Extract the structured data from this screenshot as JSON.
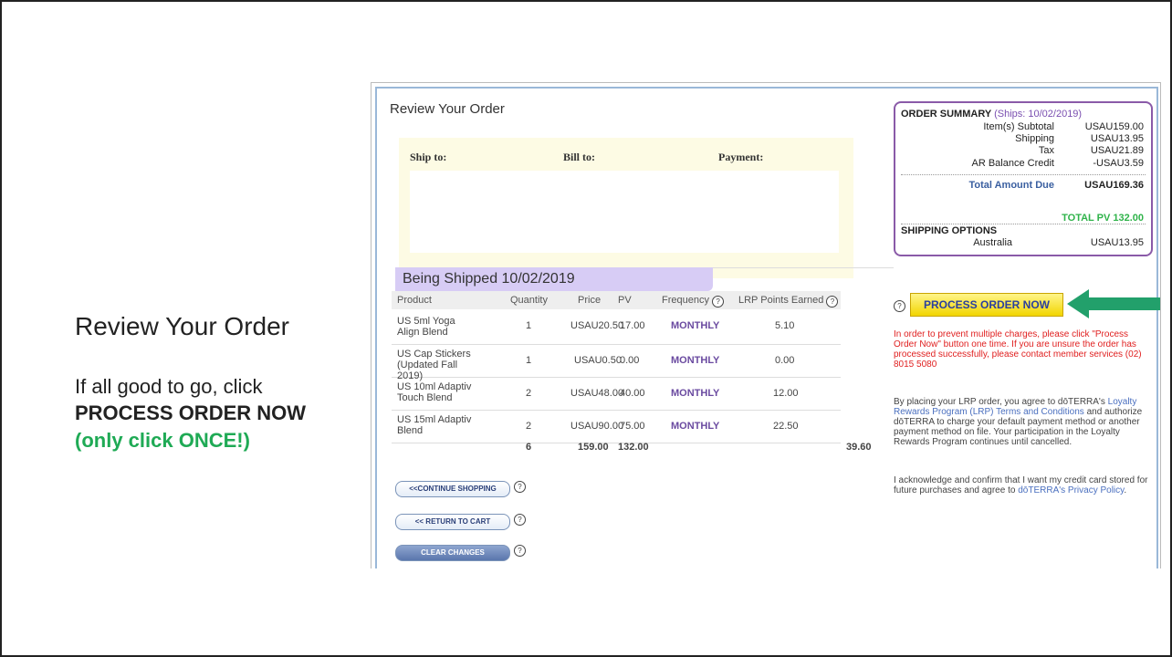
{
  "slide": {
    "title": "Review Your Order",
    "instruction": "If all good to go, click",
    "action": "PROCESS ORDER NOW",
    "note": "(only click ONCE!)"
  },
  "page": {
    "title": "Review Your Order",
    "ship_to": "Ship to:",
    "bill_to": "Bill to:",
    "payment": "Payment:"
  },
  "summary": {
    "heading": "ORDER SUMMARY",
    "ships": "(Ships: 10/02/2019)",
    "rows": [
      {
        "label": "Item(s) Subtotal",
        "value": "USAU159.00"
      },
      {
        "label": "Shipping",
        "value": "USAU13.95"
      },
      {
        "label": "Tax",
        "value": "USAU21.89"
      },
      {
        "label": "AR Balance Credit",
        "value": "-USAU3.59"
      }
    ],
    "total_label": "Total Amount Due",
    "total_value": "USAU169.36",
    "total_pv": "TOTAL PV 132.00",
    "shipping_heading": "SHIPPING OPTIONS",
    "shipping_country": "Australia",
    "shipping_value": "USAU13.95"
  },
  "shipment": {
    "title": "Being Shipped 10/02/2019",
    "headers": {
      "product": "Product",
      "quantity": "Quantity",
      "price": "Price",
      "pv": "PV",
      "frequency": "Frequency",
      "lrp": "LRP Points Earned"
    },
    "items": [
      {
        "product": "US 5ml Yoga Align Blend",
        "qty": "1",
        "price": "USAU20.50",
        "pv": "17.00",
        "freq": "MONTHLY",
        "lrp": "5.10"
      },
      {
        "product": "US Cap Stickers (Updated Fall 2019)",
        "qty": "1",
        "price": "USAU0.50",
        "pv": "0.00",
        "freq": "MONTHLY",
        "lrp": "0.00"
      },
      {
        "product": "US 10ml Adaptiv Touch Blend",
        "qty": "2",
        "price": "USAU48.00",
        "pv": "40.00",
        "freq": "MONTHLY",
        "lrp": "12.00"
      },
      {
        "product": "US 15ml Adaptiv Blend",
        "qty": "2",
        "price": "USAU90.00",
        "pv": "75.00",
        "freq": "MONTHLY",
        "lrp": "22.50"
      }
    ],
    "totals": {
      "qty": "6",
      "price": "159.00",
      "pv": "132.00",
      "lrp": "39.60"
    }
  },
  "buttons": {
    "continue_shopping": "<<CONTINUE SHOPPING",
    "return_to_cart": "<< RETURN TO CART",
    "clear_changes": "CLEAR CHANGES",
    "process_order": "PROCESS ORDER NOW"
  },
  "help_glyph": "?",
  "notes": {
    "warning": "In order to prevent multiple charges, please click \"Process Order Now\" button one time. If you are unsure the order has processed successfully, please contact member services (02) 8015 5080",
    "agree_prefix": "By placing your LRP order, you agree to dōTERRA's",
    "agree_link": "Loyalty Rewards Program (LRP) Terms and Conditions",
    "agree_suffix": "and authorize dōTERRA to charge your default payment method or another payment method on file. Your participation in the Loyalty Rewards Program continues until cancelled.",
    "ack_prefix": "I acknowledge and confirm that I want my credit card stored for future purchases and agree to",
    "ack_link": "dōTERRA's Privacy Policy",
    "ack_suffix": "."
  },
  "colors": {
    "accent_green": "#1faa55",
    "arrow_green": "#22a06b",
    "summary_border": "#8a5aa8",
    "warning_red": "#e02020",
    "process_yellow": "#f2d500"
  },
  "icons": {
    "help": "question-circle-icon",
    "pointer": "arrow-left-icon"
  }
}
